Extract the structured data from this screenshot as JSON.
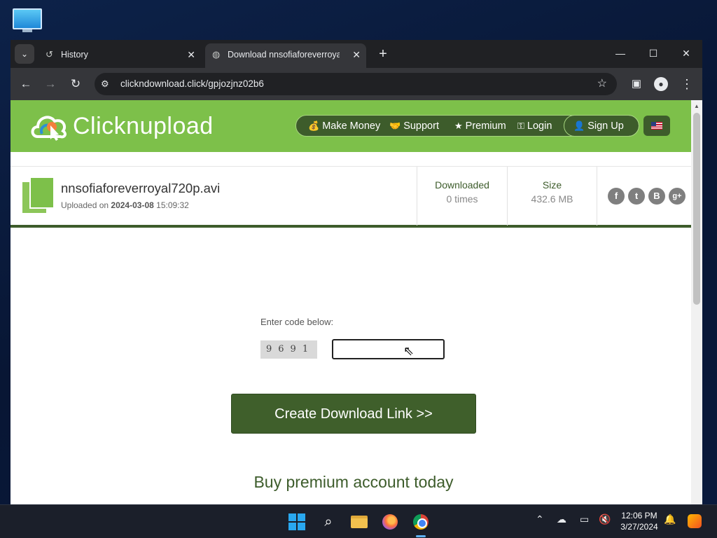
{
  "browser": {
    "tabs": [
      {
        "label": "History",
        "icon": "history-icon"
      },
      {
        "label": "Download nnsofiaforeverroyal7",
        "icon": "globe-icon"
      }
    ],
    "new_tab": "+",
    "url": "clickndownload.click/gpjozjnz02b6"
  },
  "site": {
    "brand": "Clicknupload",
    "nav": {
      "make_money": "Make Money",
      "support": "Support",
      "premium": "Premium",
      "login": "Login",
      "signup": "Sign Up"
    }
  },
  "file": {
    "name": "nnsofiaforeverroyal720p.avi",
    "uploaded_prefix": "Uploaded on",
    "uploaded_date": "2024-03-08",
    "uploaded_time": "15:09:32",
    "downloaded_label": "Downloaded",
    "downloaded_value": "0 times",
    "size_label": "Size",
    "size_value": "432.6 MB",
    "social": [
      "f",
      "t",
      "B",
      "g+"
    ]
  },
  "captcha": {
    "label": "Enter code below:",
    "code": "9691",
    "input_value": ""
  },
  "actions": {
    "create_link": "Create Download Link >>",
    "premium_heading": "Buy premium account today"
  },
  "taskbar": {
    "time": "12:06 PM",
    "date": "3/27/2024"
  },
  "colors": {
    "header_green": "#7dc04a",
    "nav_dark_green": "#3d5c2b",
    "button_green": "#3f5f2b"
  }
}
